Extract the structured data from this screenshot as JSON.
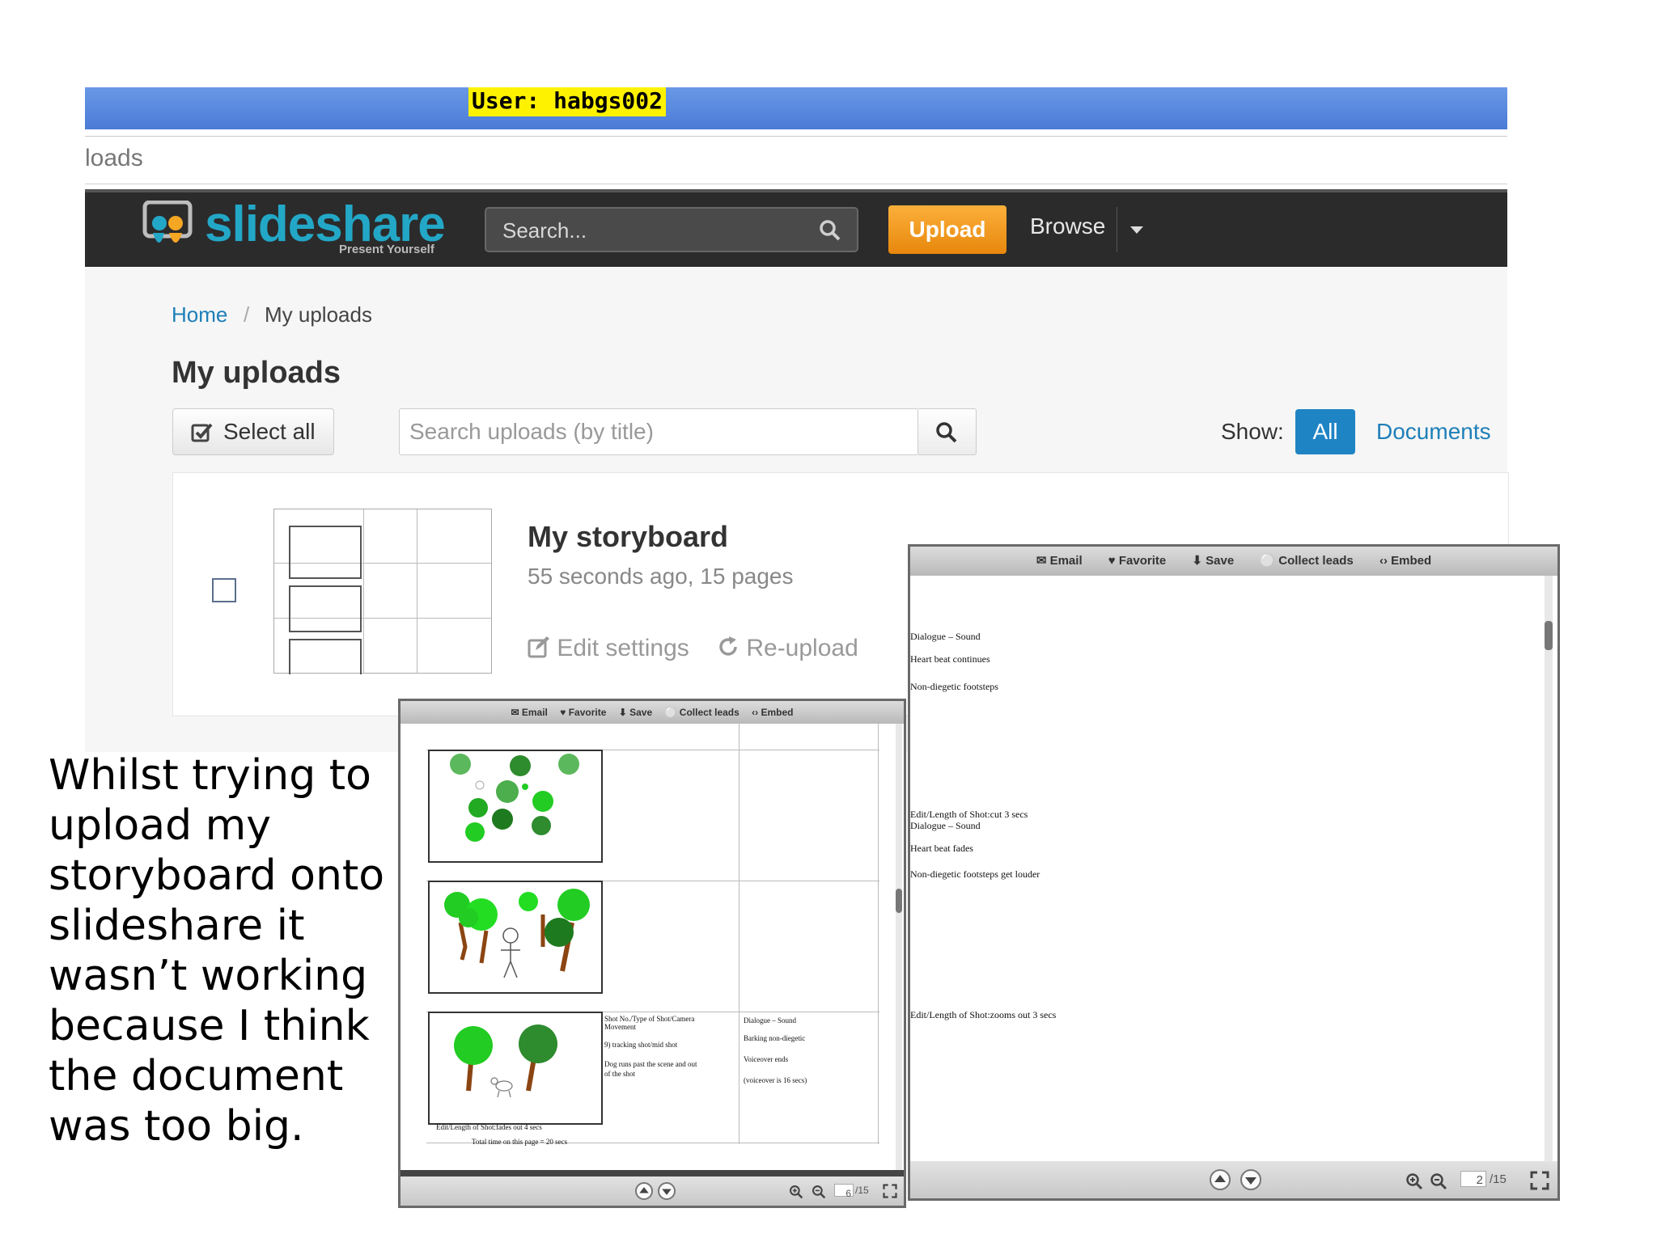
{
  "user_bar": {
    "label": "User:  habgs002"
  },
  "browser_tab": {
    "partial_title": "loads"
  },
  "header": {
    "brand": "slideshare",
    "tagline": "Present Yourself",
    "search_placeholder": "Search...",
    "upload_label": "Upload",
    "browse_label": "Browse",
    "colors": {
      "bar": "#2b2b2b",
      "upload": "#f39c1e",
      "brand": "#23a7c7"
    }
  },
  "breadcrumb": {
    "home": "Home",
    "separator": "/",
    "current": "My uploads"
  },
  "page_title": "My uploads",
  "toolbar": {
    "select_all": "Select all",
    "search_placeholder": "Search uploads (by title)",
    "show_label": "Show:",
    "show_all": "All",
    "show_documents": "Documents"
  },
  "upload_item": {
    "title": "My storyboard",
    "meta": "55 seconds ago, 15 pages",
    "edit_settings": "Edit settings",
    "reupload": "Re-upload"
  },
  "caption": "Whilst trying to upload my storyboard onto slideshare it wasn’t working because I think the document was too big.",
  "viewer_toolbar": {
    "email": "Email",
    "favorite": "Favorite",
    "save": "Save",
    "collect_leads": "Collect leads",
    "embed": "Embed"
  },
  "viewer_big": {
    "page_current": "2",
    "page_total": "/15",
    "lines": [
      "Dialogue – Sound",
      "Heart beat continues",
      "Non-diegetic footsteps",
      "Edit/Length of Shot:cut 3 secs",
      "Dialogue – Sound",
      "Heart beat fades",
      "Non-diegetic footsteps get louder",
      "Edit/Length of Shot:zooms out 3 secs"
    ]
  },
  "viewer_small": {
    "page_current": "6",
    "page_total": "/15",
    "shot_text": [
      "Shot No./Type of Shot/Camera",
      "Movement",
      "9) tracking shot/mid shot",
      "Dog runs past the scene and out",
      "of the shot"
    ],
    "sound_text": [
      "Dialogue – Sound",
      "Barking non-diegetic",
      "Voiceover ends",
      "(voiceover is 16 secs)"
    ],
    "edit_text": "Edit/Length of Shot:fades out 4 secs",
    "total_time": "Total time on this page = 20 secs"
  }
}
